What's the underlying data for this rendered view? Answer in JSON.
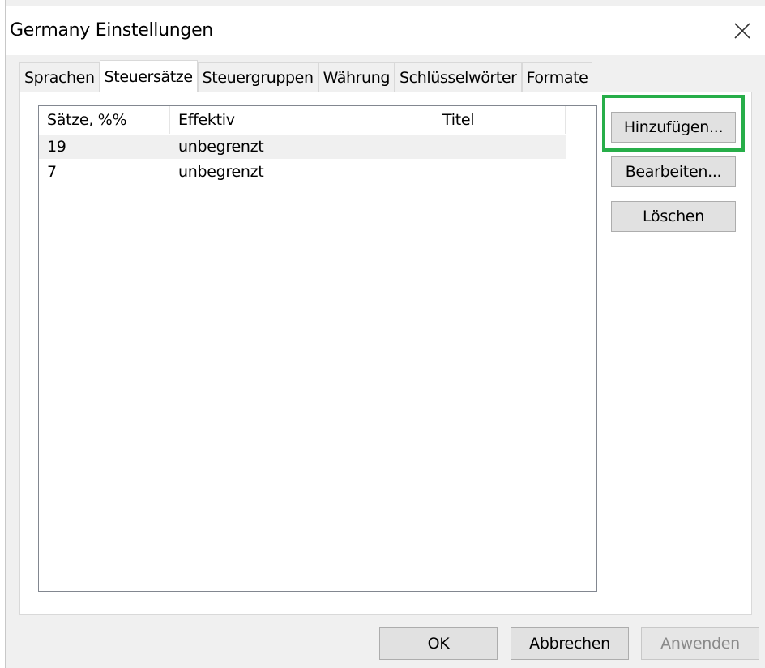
{
  "window": {
    "title": "Germany Einstellungen",
    "close_icon": "close-icon"
  },
  "tabs": [
    {
      "label": "Sprachen",
      "active": false
    },
    {
      "label": "Steuersätze",
      "active": true
    },
    {
      "label": "Steuergruppen",
      "active": false
    },
    {
      "label": "Währung",
      "active": false
    },
    {
      "label": "Schlüsselwörter",
      "active": false
    },
    {
      "label": "Formate",
      "active": false
    }
  ],
  "rates_table": {
    "columns": [
      "Sätze, %%",
      "Effektiv",
      "Titel"
    ],
    "rows": [
      {
        "rate": "19",
        "effective": "unbegrenzt",
        "title": "",
        "selected": true
      },
      {
        "rate": "7",
        "effective": "unbegrenzt",
        "title": "",
        "selected": false
      }
    ]
  },
  "side_buttons": {
    "add": "Hinzufügen...",
    "edit": "Bearbeiten...",
    "delete": "Löschen"
  },
  "footer_buttons": {
    "ok": "OK",
    "cancel": "Abbrechen",
    "apply": "Anwenden"
  },
  "colors": {
    "highlight": "#27ae49",
    "selected_row": "#f0f0f0",
    "dialog_bg": "#f0f0f0"
  }
}
